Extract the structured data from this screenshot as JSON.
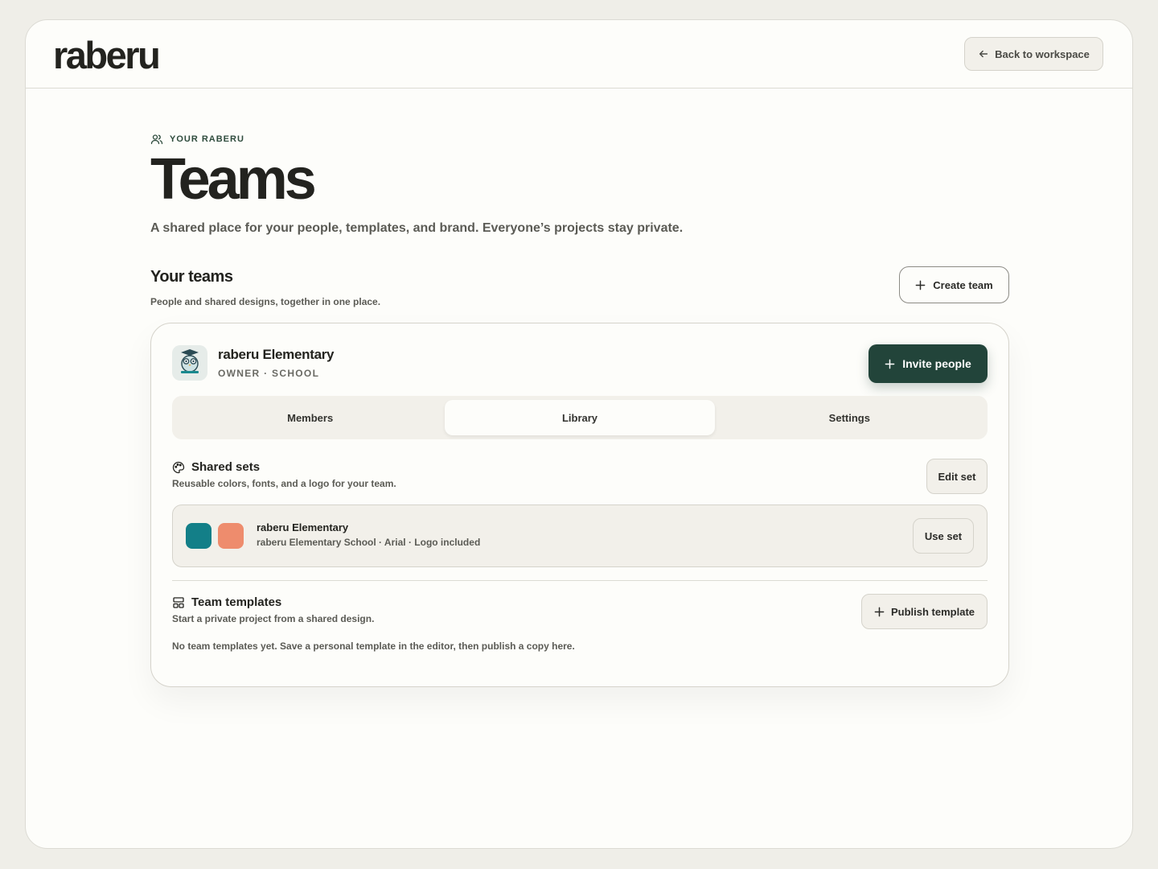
{
  "app": {
    "logo": "raberu"
  },
  "header": {
    "back_label": "Back to workspace",
    "back_icon": "arrow-left-icon"
  },
  "page": {
    "eyebrow": "YOUR RABERU",
    "eyebrow_icon": "users-icon",
    "title": "Teams",
    "subtitle": "A shared place for your people, templates, and brand. Everyone’s projects stay private."
  },
  "teams_section": {
    "title": "Your teams",
    "description": "People and shared designs, together in one place.",
    "create_label": "Create team"
  },
  "team": {
    "name": "raberu Elementary",
    "meta": "OWNER · SCHOOL",
    "avatar_label": "raberu",
    "invite_label": "Invite people",
    "tabs": [
      {
        "label": "Members",
        "active": false
      },
      {
        "label": "Library",
        "active": true
      },
      {
        "label": "Settings",
        "active": false
      }
    ]
  },
  "shared_sets": {
    "title": "Shared sets",
    "icon": "palette-icon",
    "description": "Reusable colors, fonts, and a logo for your team.",
    "edit_label": "Edit set",
    "set": {
      "name": "raberu Elementary",
      "meta": "raberu Elementary School · Arial · Logo included",
      "colors": [
        "#137f88",
        "#ee8c6d"
      ],
      "use_label": "Use set"
    }
  },
  "team_templates": {
    "title": "Team templates",
    "icon": "layout-icon",
    "description": "Start a private project from a shared design.",
    "publish_label": "Publish template",
    "empty_text": "No team templates yet. Save a personal template in the editor, then publish a copy here."
  },
  "colors": {
    "primary": "#22443a",
    "background": "#fdfdfa",
    "muted": "#f2f0ea"
  }
}
